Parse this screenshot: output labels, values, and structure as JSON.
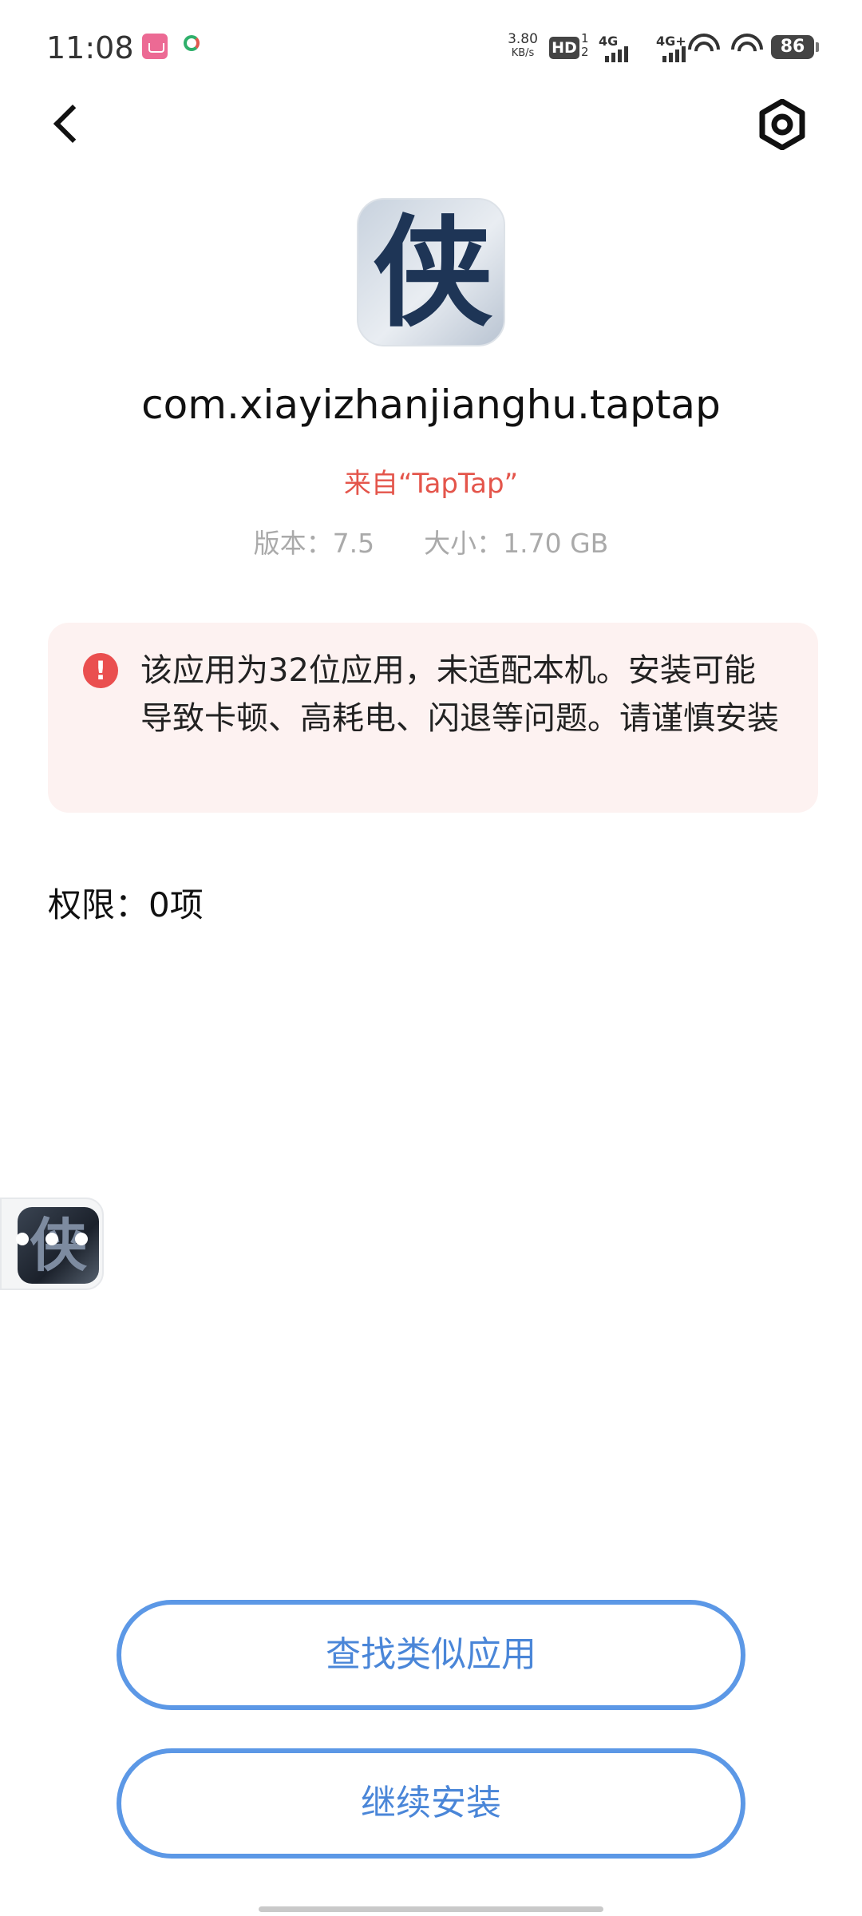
{
  "status_bar": {
    "time": "11:08",
    "net_speed_value": "3.80",
    "net_speed_unit": "KB/s",
    "hd_label": "HD",
    "hd_sub_top": "1",
    "hd_sub_bottom": "2",
    "sim1_label": "4G",
    "sim2_label": "4G+",
    "battery_level": "86",
    "icons": [
      "bilibili-icon",
      "network-service-icon",
      "hd-voice-icon",
      "signal-4g-icon",
      "signal-4g-plus-icon",
      "wifi-icon",
      "wifi-icon",
      "battery-icon"
    ]
  },
  "toolbar": {
    "back_icon": "chevron-left-icon",
    "settings_icon": "gear-icon"
  },
  "app": {
    "icon_glyph": "侠",
    "package_name": "com.xiayizhanjianghu.taptap",
    "source": "来自“TapTap”",
    "version": "版本：7.5",
    "size": "大小：1.70 GB"
  },
  "warning": {
    "icon": "exclamation-icon",
    "text": "该应用为32位应用，未适配本机。安装可能导致卡顿、高耗电、闪退等问题。请谨慎安装"
  },
  "permissions": {
    "label": "权限：0项"
  },
  "floating_bubble": {
    "glyph": "侠"
  },
  "buttons": {
    "find_similar": "查找类似应用",
    "continue_install": "继续安装"
  },
  "colors": {
    "accent": "#4a86d8",
    "source_red": "#e4554b",
    "warning_bg": "#fdf2f1",
    "warning_icon": "#ea4f4f",
    "meta_gray": "#aaaaaa"
  }
}
